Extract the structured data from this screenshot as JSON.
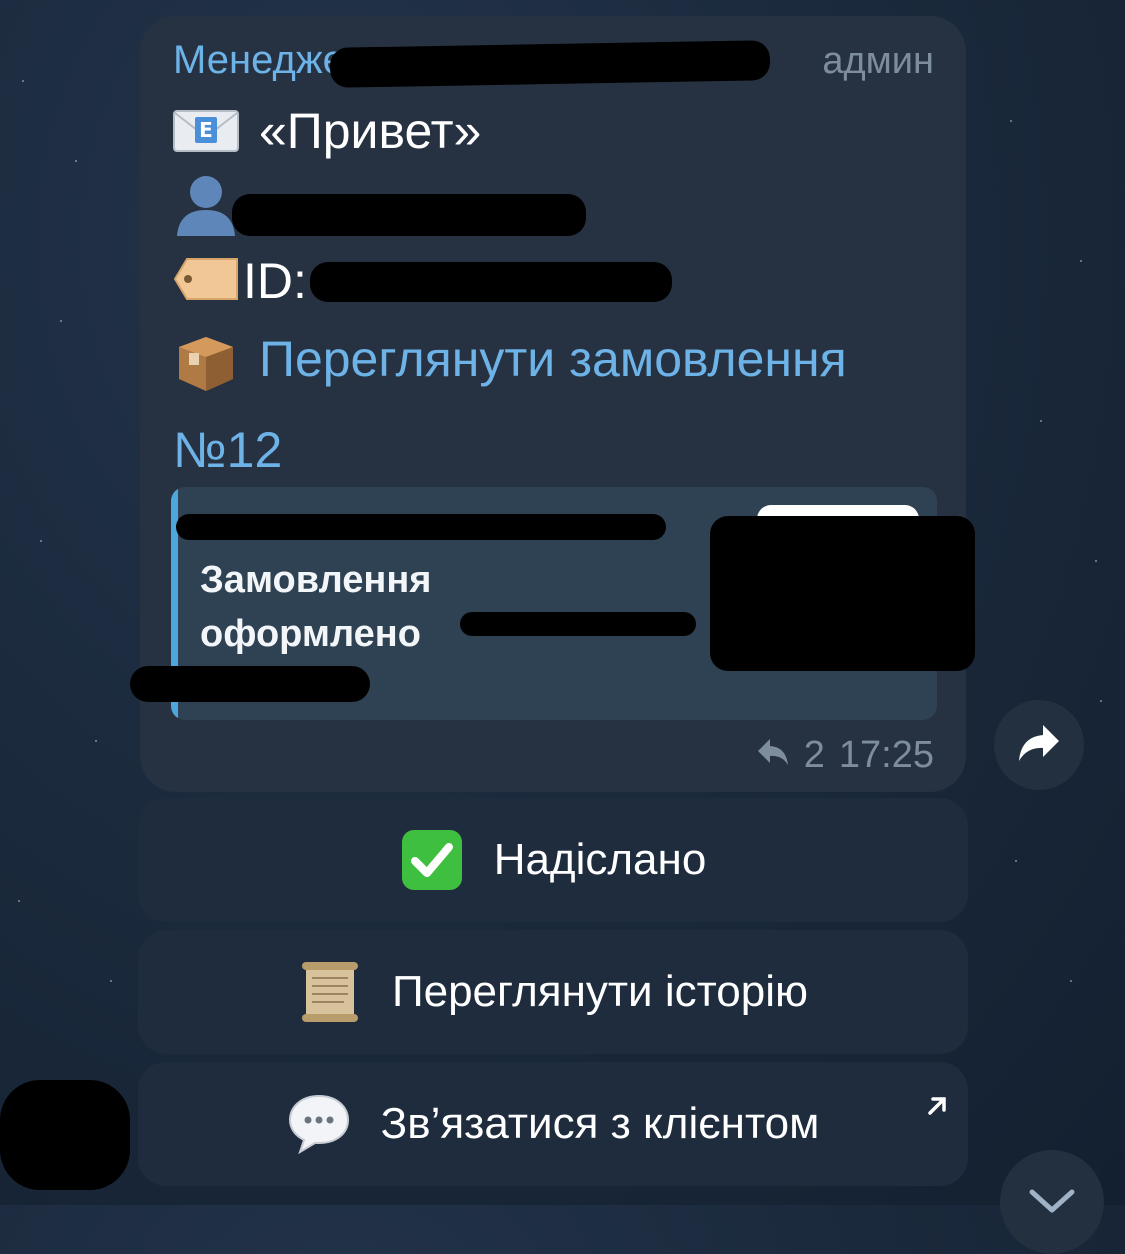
{
  "message": {
    "sender_name": "Менеджер",
    "admin_label": "админ",
    "greeting": "«Привет»",
    "id_label": "ID:",
    "order_link_text": "Переглянути замовлення",
    "order_number": "№12",
    "link_preview": {
      "title": "Замовлення оформлено"
    },
    "reply_count": "2",
    "time": "17:25"
  },
  "keyboard": {
    "sent_label": "Надіслано",
    "history_label": "Переглянути історію",
    "contact_label": "Зв’язатися з клієнтом"
  },
  "icons": {
    "greeting": "envelope-e-icon",
    "user": "user-silhouette-icon",
    "id": "tag-icon",
    "order": "package-icon",
    "sent": "check-mark-icon",
    "history": "scroll-icon",
    "contact": "speech-bubble-icon"
  },
  "colors": {
    "link": "#6db3e8",
    "bubble": "#263241",
    "button": "#1e2c3d",
    "check": "#3fbf3f"
  }
}
